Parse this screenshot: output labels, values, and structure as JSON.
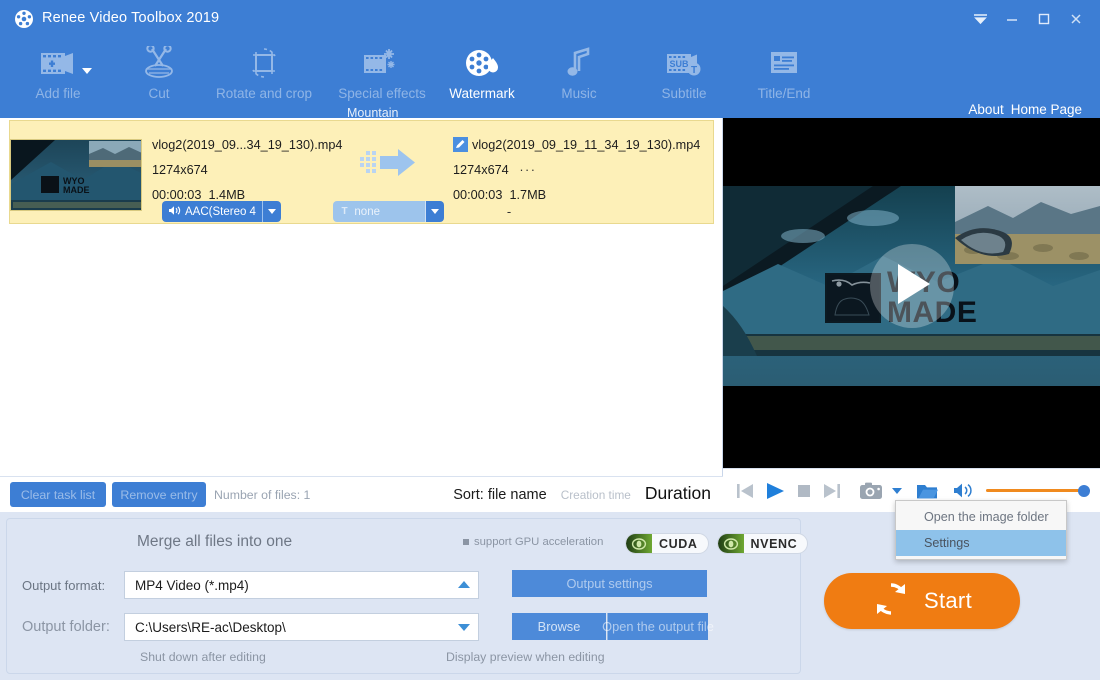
{
  "window": {
    "title": "Renee Video Toolbox 2019",
    "logo_icon": "film-reel-icon",
    "controls": [
      {
        "name": "skin-menu-button",
        "icon": "chevron-down-icon"
      },
      {
        "name": "minimize-button",
        "icon": "minimize-icon"
      },
      {
        "name": "maximize-button",
        "icon": "maximize-icon"
      },
      {
        "name": "close-button",
        "icon": "close-icon"
      }
    ],
    "accent_color": "#3d7ed4",
    "start_color": "#f07c12"
  },
  "toolbar": {
    "items": [
      {
        "label": "Add file",
        "icon": "film-plus-icon",
        "dim": true,
        "has_caret": true
      },
      {
        "label": "Cut",
        "icon": "scissors-icon",
        "dim": true,
        "has_caret": false
      },
      {
        "label": "Rotate and crop",
        "icon": "rotate-crop-icon",
        "dim": true,
        "has_caret": false
      },
      {
        "label": "Special effects",
        "icon": "film-sparkle-icon",
        "dim": true,
        "has_caret": false
      },
      {
        "label": "Watermark",
        "icon": "reel-droplet-icon",
        "dim": false,
        "has_caret": false
      },
      {
        "label": "Music",
        "icon": "music-note-icon",
        "dim": true,
        "has_caret": false
      },
      {
        "label": "Subtitle",
        "icon": "sub-t-icon",
        "dim": true,
        "has_caret": false
      },
      {
        "label": "Title/End",
        "icon": "text-page-icon",
        "dim": true,
        "has_caret": false
      }
    ],
    "tooltip": "Mountain",
    "links": [
      {
        "label": "About"
      },
      {
        "label": "Home Page"
      }
    ]
  },
  "task_list": {
    "rows": [
      {
        "thumbnail_icon": "video-thumbnail",
        "source": {
          "name": "vlog2(2019_09...34_19_130).mp4",
          "resolution": "1274x674",
          "duration": "00:00:03",
          "size": "1.4MB"
        },
        "arrow_icon": "convert-arrow-icon",
        "target": {
          "edit_icon": "pencil-edit-icon",
          "name": "vlog2(2019_09_19_11_34_19_130).mp4",
          "resolution": "1274x674",
          "resolution_more": "···",
          "duration": "00:00:03",
          "size": "1.7MB"
        },
        "audio_track": {
          "icon": "speaker-icon",
          "label": "AAC(Stereo 4",
          "caret_icon": "caret-down-icon",
          "selected": false
        },
        "subtitle_track": {
          "icon": "subtitle-t-icon",
          "label": "none",
          "caret_icon": "caret-down-icon",
          "selected": true
        },
        "third_value": "-"
      }
    ]
  },
  "list_toolbar": {
    "clear_task_list": "Clear task list",
    "remove_entry": "Remove entry",
    "number_of_files": "Number of files: 1",
    "sort_label": "Sort: file name",
    "sort_creation_time": "Creation time",
    "sort_duration": "Duration"
  },
  "settings": {
    "merge_all_label": "Merge all files into one",
    "merge_all_checked": false,
    "gpu_note": "support GPU acceleration",
    "gpu_badges": [
      {
        "label": "CUDA",
        "icon": "nvidia-eye-icon"
      },
      {
        "label": "NVENC",
        "icon": "nvidia-eye-icon"
      }
    ],
    "output_format_label": "Output format:",
    "output_format_value": "MP4 Video (*.mp4)",
    "output_format_arrow": "caret-up-icon",
    "output_settings_button": "Output settings",
    "output_folder_label": "Output folder:",
    "output_folder_value": "C:\\Users\\RE-ac\\Desktop\\",
    "output_folder_arrow": "caret-down-icon",
    "browse_button": "Browse",
    "open_output_button": "Open the output file",
    "shutdown_label": "Shut down after editing",
    "shutdown_checked": false,
    "preview_label": "Display preview when editing",
    "preview_checked": false,
    "start_button": "Start",
    "start_icon": "refresh-circle-icon"
  },
  "player": {
    "overlay_text_line1": "WYO",
    "overlay_text_line2": "MADE",
    "play_icon": "play-triangle-icon",
    "controls": [
      {
        "name": "previous-frame-button",
        "icon": "skip-back-icon"
      },
      {
        "name": "play-button",
        "icon": "play-icon"
      },
      {
        "name": "stop-button",
        "icon": "stop-square-icon"
      },
      {
        "name": "next-frame-button",
        "icon": "skip-forward-icon"
      },
      {
        "name": "snapshot-button",
        "icon": "camera-icon"
      },
      {
        "name": "snapshot-menu-button",
        "icon": "caret-down-icon"
      },
      {
        "name": "open-folder-button",
        "icon": "folder-icon"
      },
      {
        "name": "volume-button",
        "icon": "speaker-icon"
      },
      {
        "name": "fullscreen-button",
        "icon": "expand-arrows-icon"
      }
    ],
    "volume_value": 100
  },
  "context_menu": {
    "items": [
      {
        "label": "Open the image folder",
        "highlighted": false
      },
      {
        "label": "Settings",
        "highlighted": true
      }
    ]
  }
}
